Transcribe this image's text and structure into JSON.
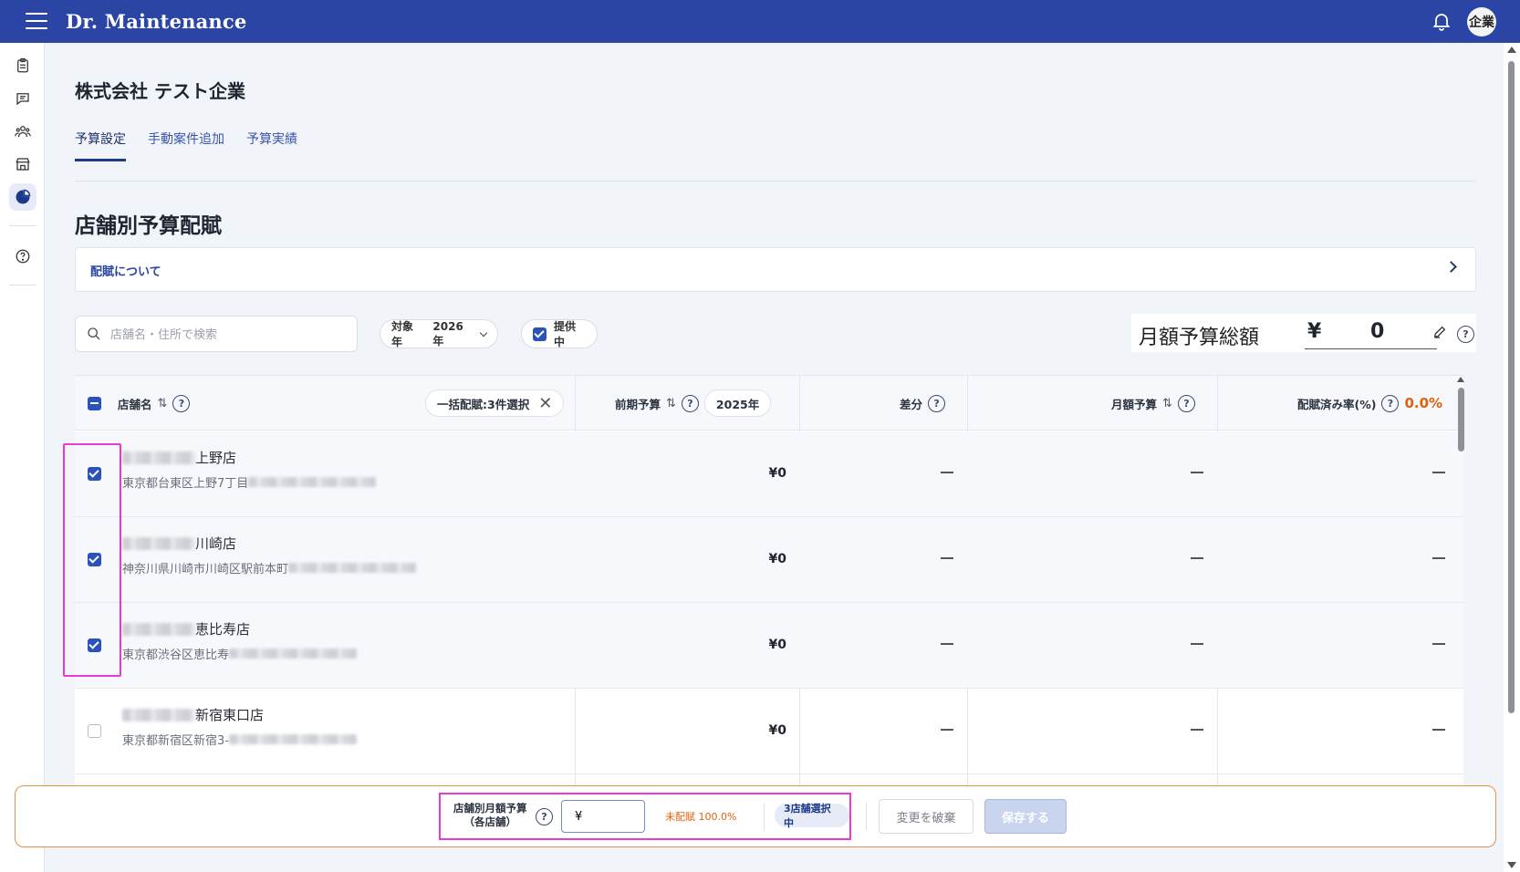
{
  "app": {
    "brand": "Dr. Maintenance",
    "avatar_text": "企業"
  },
  "page": {
    "company": "株式会社 テスト企業",
    "tabs": [
      {
        "label": "予算設定",
        "active": true
      },
      {
        "label": "手動案件追加",
        "active": false
      },
      {
        "label": "予算実績",
        "active": false
      }
    ],
    "section_title": "店舗別予算配賦",
    "about_link": "配賦について"
  },
  "filters": {
    "search_placeholder": "店舗名・住所で検索",
    "year_label": "対象年",
    "year_value": "2026年",
    "active_label": "提供中",
    "active_checked": true
  },
  "budget_total": {
    "label": "月額予算総額",
    "currency": "¥",
    "value": "0"
  },
  "table": {
    "headers": {
      "store_name": "店舗名",
      "bulk_chip": "一括配賦:3件選択",
      "prev_budget": "前期予算",
      "prev_year_chip": "2025年",
      "diff": "差分",
      "monthly_budget": "月額予算",
      "alloc_rate": "配賦済み率(%)",
      "alloc_rate_value": "0.0%"
    },
    "rows": [
      {
        "name_suffix": "上野店",
        "address": "東京都台東区上野7丁目",
        "prev": "¥0",
        "checked": true
      },
      {
        "name_suffix": "川崎店",
        "address": "神奈川県川崎市川崎区駅前本町",
        "prev": "¥0",
        "checked": true
      },
      {
        "name_suffix": "恵比寿店",
        "address": "東京都渋谷区恵比寿",
        "prev": "¥0",
        "checked": true
      },
      {
        "name_suffix": "新宿東口店",
        "address": "東京都新宿区新宿3-",
        "prev": "¥0",
        "checked": false
      }
    ]
  },
  "bottom_bar": {
    "label_line1": "店舗別月額予算",
    "label_line2": "（各店舗）",
    "input_value": "¥",
    "unallocated": "未配賦 100.0%",
    "selected_count": "3店舗選択中",
    "discard": "変更を破棄",
    "save": "保存する"
  },
  "colors": {
    "primary": "#2a45a3",
    "accent_orange": "#e0610e",
    "highlight": "#e93ad8"
  }
}
